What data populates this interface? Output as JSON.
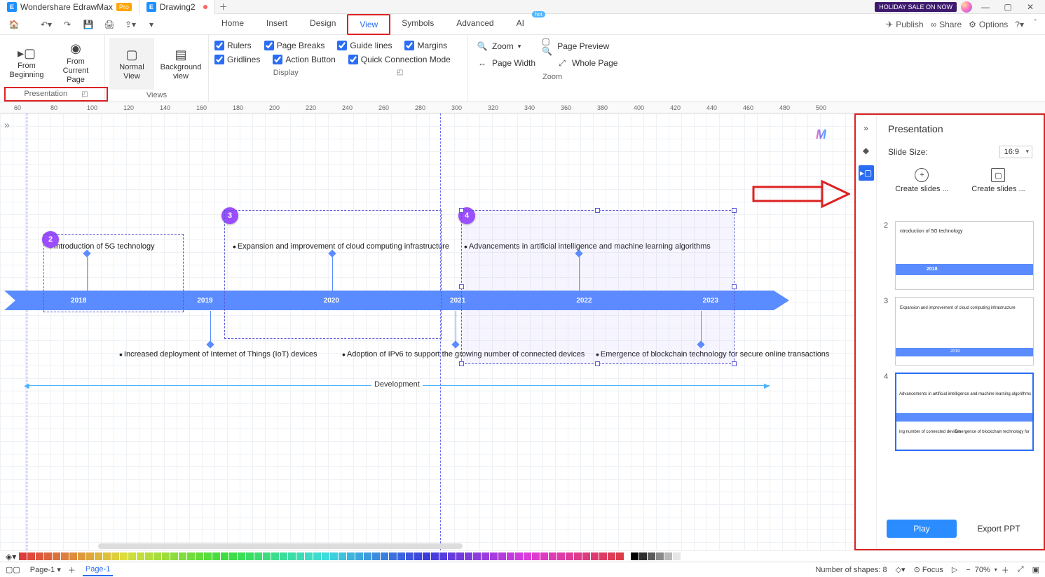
{
  "app": {
    "title": "Wondershare EdrawMax",
    "pro": "Pro",
    "doc_tab": "Drawing2",
    "holiday": "HOLIDAY SALE ON NOW"
  },
  "menu": {
    "items": {
      "home": "Home",
      "insert": "Insert",
      "design": "Design",
      "view": "View",
      "symbols": "Symbols",
      "advanced": "Advanced",
      "ai": "AI"
    },
    "right": {
      "publish": "Publish",
      "share": "Share",
      "options": "Options"
    }
  },
  "ribbon": {
    "presentation": {
      "from_beginning": "From\nBeginning",
      "from_current": "From Current\nPage",
      "label": "Presentation"
    },
    "views": {
      "normal": "Normal\nView",
      "background": "Background\nview",
      "label": "Views"
    },
    "display": {
      "rulers": "Rulers",
      "page_breaks": "Page Breaks",
      "guide_lines": "Guide lines",
      "margins": "Margins",
      "gridlines": "Gridlines",
      "action_button": "Action Button",
      "quick_conn": "Quick Connection Mode",
      "label": "Display"
    },
    "zoom": {
      "zoom": "Zoom",
      "preview": "Page Preview",
      "width": "Page Width",
      "whole": "Whole Page",
      "label": "Zoom"
    }
  },
  "ruler_ticks": [
    "60",
    "80",
    "100",
    "120",
    "140",
    "160",
    "180",
    "200",
    "220",
    "240",
    "260",
    "280",
    "300",
    "320",
    "340",
    "360",
    "380",
    "400",
    "420",
    "440",
    "460",
    "480",
    "500"
  ],
  "timeline": {
    "years": [
      "2018",
      "2019",
      "2020",
      "2021",
      "2022",
      "2023"
    ],
    "markers": {
      "m2": "2",
      "m3": "3",
      "m4": "4"
    },
    "notes": {
      "n1": "Introduction of 5G technology",
      "n2": "Expansion and improvement of cloud computing infrastructure",
      "n3": "Advancements in artificial intelligence and machine learning algorithms",
      "n4": "Increased deployment of Internet of Things (IoT) devices",
      "n5": "Adoption of IPv6 to support the growing number of connected devices",
      "n6": "Emergence of blockchain technology for secure online transactions"
    },
    "devline": "Development"
  },
  "panel": {
    "title": "Presentation",
    "slide_size_label": "Slide Size:",
    "slide_size_value": "16:9",
    "create1": "Create slides ...",
    "create2": "Create slides ...",
    "slides": {
      "s2": {
        "num": "2",
        "caption": "ntroduction of 5G technology",
        "year": "2018"
      },
      "s3": {
        "num": "3",
        "caption": "Expansion and improvement of cloud computing infrastructure",
        "year": "2019"
      },
      "s4": {
        "num": "4",
        "cap_top": "Advancements in artificial intelligence and machine learning algorithms",
        "cap_bl": "ing number of connected devices",
        "cap_br": "Emergence of blockchain technology for"
      }
    },
    "play": "Play",
    "export": "Export PPT"
  },
  "status": {
    "pages_label": "Page-1",
    "page_active": "Page-1",
    "shapes": "Number of shapes: 8",
    "focus": "Focus",
    "zoom": "70%"
  }
}
